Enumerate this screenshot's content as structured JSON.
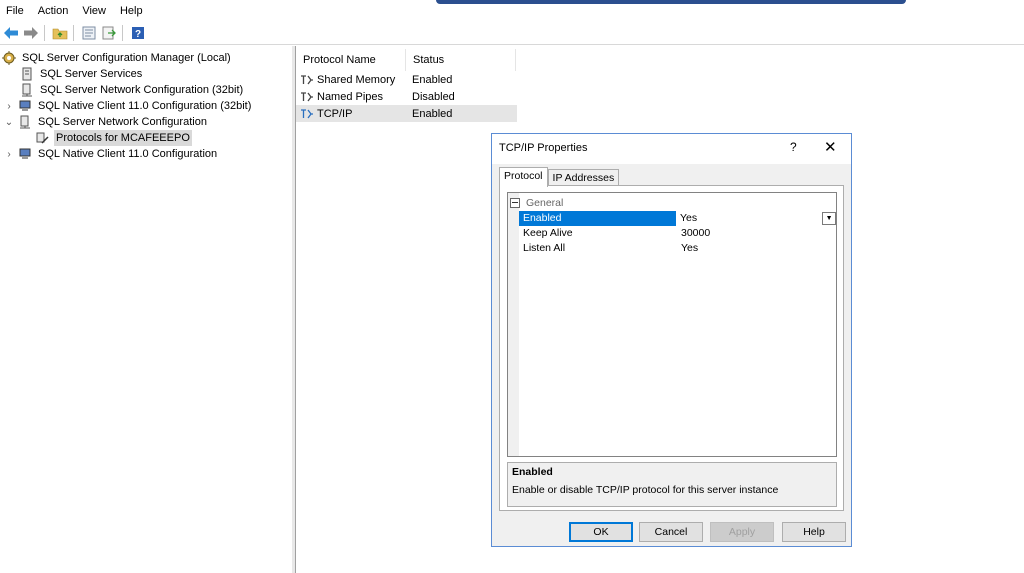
{
  "menu": [
    "File",
    "Action",
    "View",
    "Help"
  ],
  "tree": {
    "root": "SQL Server Configuration Manager (Local)",
    "items": [
      "SQL Server Services",
      "SQL Server Network Configuration (32bit)",
      "SQL Native Client 11.0 Configuration (32bit)",
      "SQL Server Network Configuration",
      "Protocols for MCAFEEEPO",
      "SQL Native Client 11.0 Configuration"
    ]
  },
  "list": {
    "headers": [
      "Protocol Name",
      "Status"
    ],
    "rows": [
      {
        "name": "Shared Memory",
        "status": "Enabled"
      },
      {
        "name": "Named Pipes",
        "status": "Disabled"
      },
      {
        "name": "TCP/IP",
        "status": "Enabled"
      }
    ]
  },
  "dialog": {
    "title": "TCP/IP Properties",
    "help_glyph": "?",
    "close_glyph": "✕",
    "tabs": [
      "Protocol",
      "IP Addresses"
    ],
    "category": "General",
    "properties": [
      {
        "name": "Enabled",
        "value": "Yes"
      },
      {
        "name": "Keep Alive",
        "value": "30000"
      },
      {
        "name": "Listen All",
        "value": "Yes"
      }
    ],
    "description_title": "Enabled",
    "description_text": "Enable or disable TCP/IP protocol for this server instance",
    "buttons": {
      "ok": "OK",
      "cancel": "Cancel",
      "apply": "Apply",
      "help": "Help"
    }
  }
}
